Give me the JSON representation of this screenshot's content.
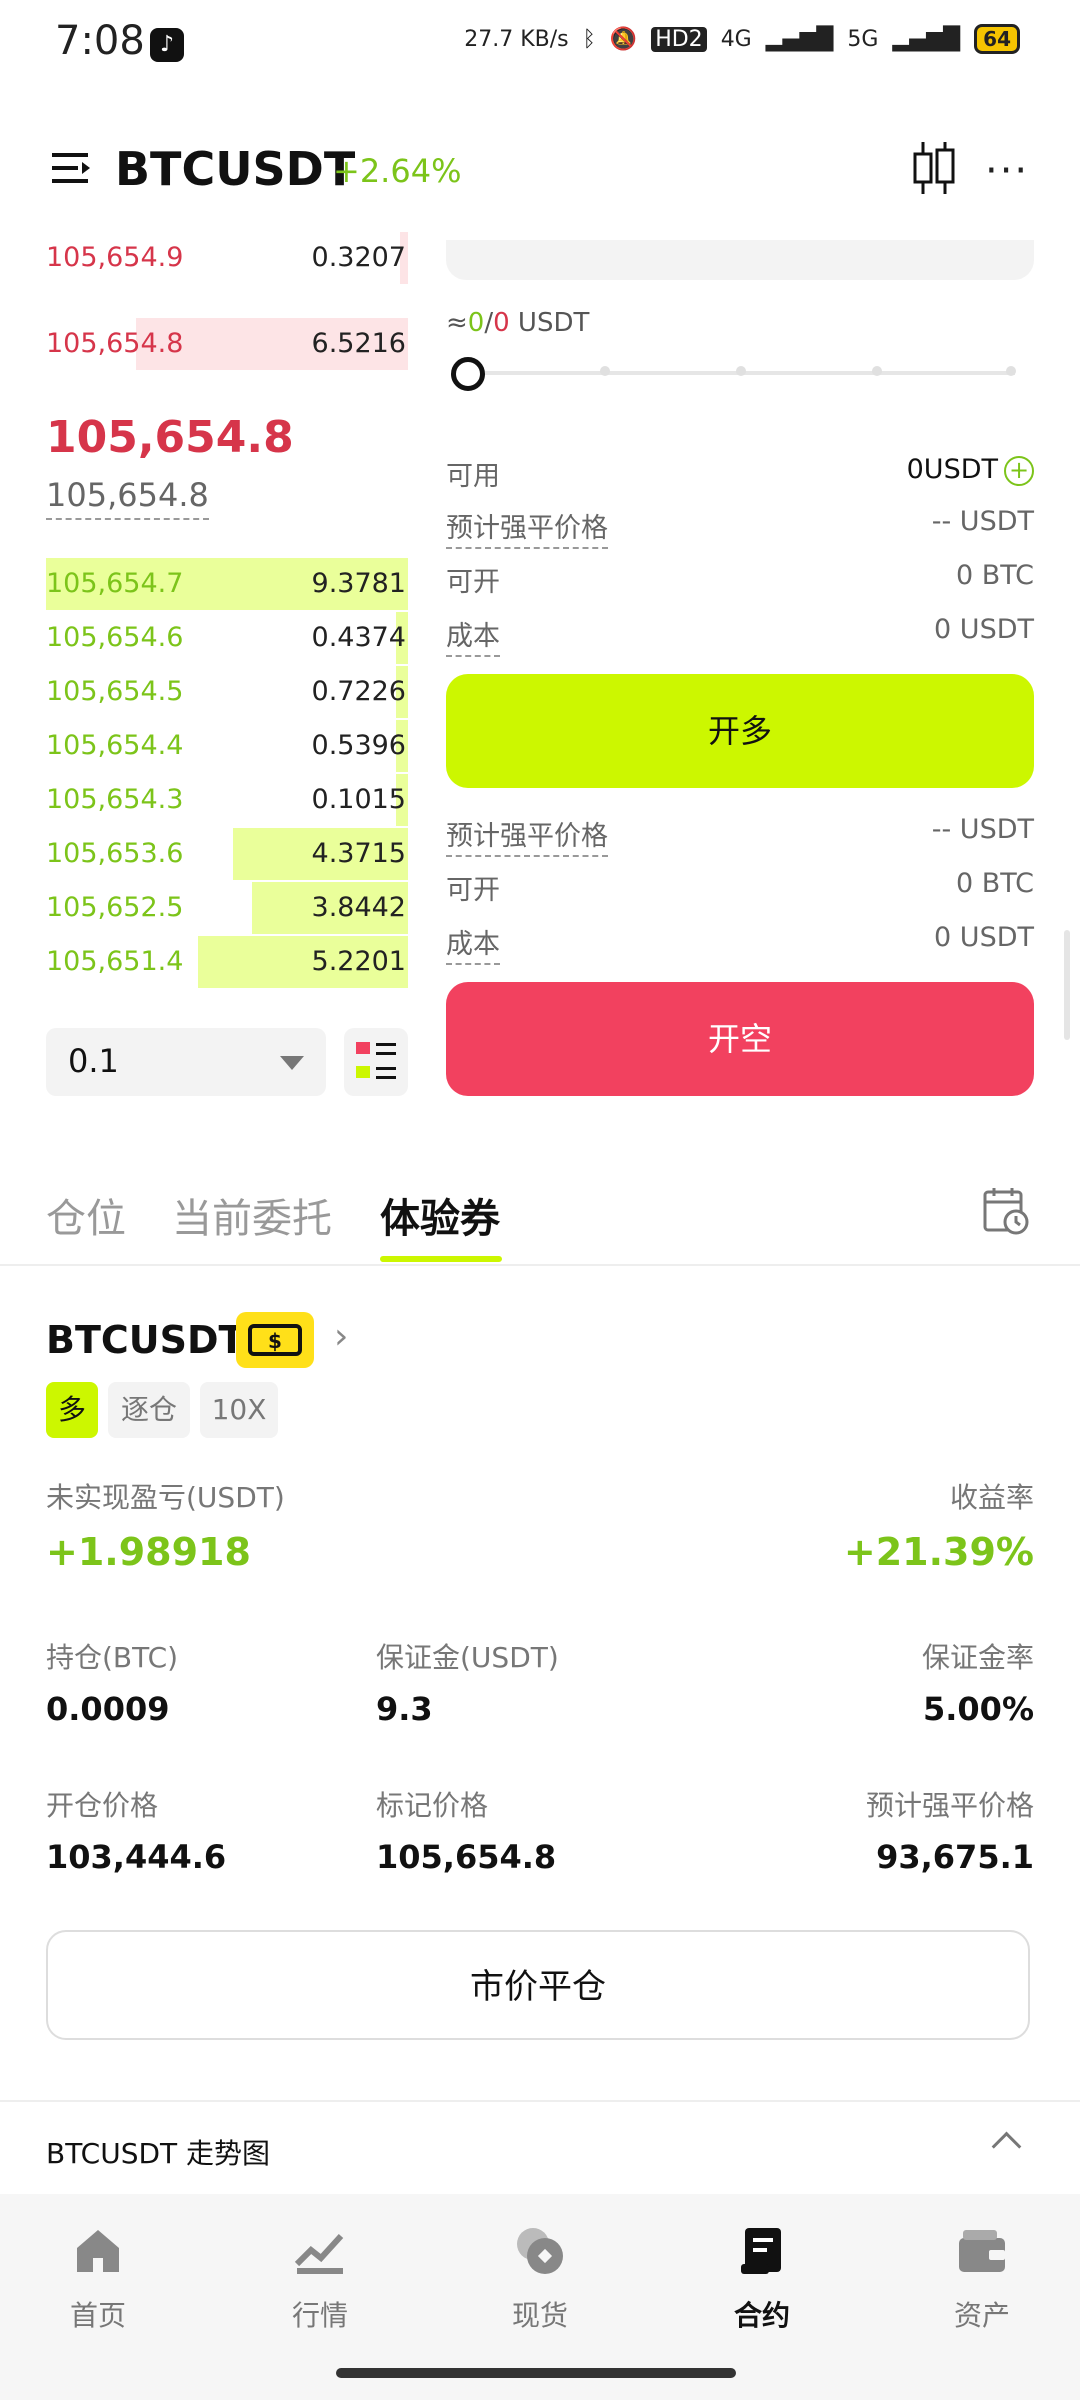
{
  "status_bar": {
    "time": "7:08",
    "net_speed": "27.7 KB/s",
    "hd": "HD2",
    "n4g": "4G",
    "n5g": "5G",
    "battery": "64"
  },
  "header": {
    "pair": "BTCUSDT",
    "change": "+2.64%",
    "icons": [
      "menu-icon",
      "candlestick-icon",
      "more-icon"
    ]
  },
  "order_book": {
    "asks": [
      {
        "price": "105,654.9",
        "qty": "0.3207"
      },
      {
        "price": "105,654.8",
        "qty": "6.5216"
      }
    ],
    "last_price": "105,654.8",
    "mark_price": "105,654.8",
    "bids": [
      {
        "price": "105,654.7",
        "qty": "9.3781"
      },
      {
        "price": "105,654.6",
        "qty": "0.4374"
      },
      {
        "price": "105,654.5",
        "qty": "0.7226"
      },
      {
        "price": "105,654.4",
        "qty": "0.5396"
      },
      {
        "price": "105,654.3",
        "qty": "0.1015"
      },
      {
        "price": "105,653.6",
        "qty": "4.3715"
      },
      {
        "price": "105,652.5",
        "qty": "3.8442"
      },
      {
        "price": "105,651.4",
        "qty": "5.2201"
      }
    ],
    "precision": "0.1"
  },
  "trade_panel": {
    "approx_prefix": "≈",
    "approx_a": "0",
    "approx_sep": "/",
    "approx_b": "0",
    "approx_unit": " USDT",
    "available_label": "可用",
    "available_value": "0USDT",
    "long": {
      "liq_label": "预计强平价格",
      "liq_value": "-- USDT",
      "open_label": "可开",
      "open_value": "0 BTC",
      "cost_label": "成本",
      "cost_value": "0 USDT",
      "button": "开多"
    },
    "short": {
      "liq_label": "预计强平价格",
      "liq_value": "-- USDT",
      "open_label": "可开",
      "open_value": "0 BTC",
      "cost_label": "成本",
      "cost_value": "0 USDT",
      "button": "开空"
    }
  },
  "tabs": [
    "仓位",
    "当前委托",
    "体验券"
  ],
  "position": {
    "symbol": "BTCUSDT",
    "tags": [
      "多",
      "逐仓",
      "10X"
    ],
    "pnl_label": "未实现盈亏(USDT)",
    "pnl_value": "+1.98918",
    "roi_label": "收益率",
    "roi_value": "+21.39%",
    "size_label": "持仓(BTC)",
    "size_value": "0.0009",
    "margin_label": "保证金(USDT)",
    "margin_value": "9.3",
    "margin_rate_label": "保证金率",
    "margin_rate_value": "5.00%",
    "entry_label": "开仓价格",
    "entry_value": "103,444.6",
    "mark_label": "标记价格",
    "mark_value": "105,654.8",
    "liq_label": "预计强平价格",
    "liq_value": "93,675.1",
    "close_button": "市价平仓"
  },
  "trend": {
    "title": "BTCUSDT 走势图"
  },
  "bottom_nav": [
    {
      "label": "首页",
      "icon": "home-icon"
    },
    {
      "label": "行情",
      "icon": "market-icon"
    },
    {
      "label": "现货",
      "icon": "spot-icon"
    },
    {
      "label": "合约",
      "icon": "contract-icon"
    },
    {
      "label": "资产",
      "icon": "wallet-icon"
    }
  ],
  "colors": {
    "accent": "#ccf700",
    "up": "#7cc41a",
    "down": "#d6354a",
    "short_btn": "#f2415f"
  }
}
